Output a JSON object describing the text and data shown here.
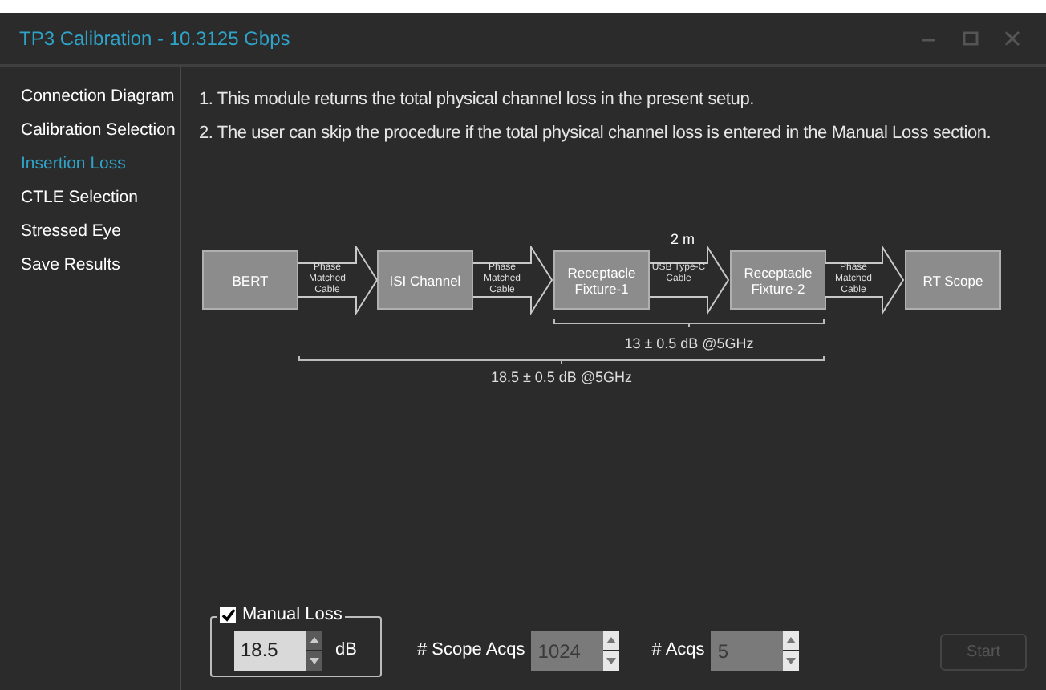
{
  "window": {
    "title": "TP3 Calibration - 10.3125 Gbps"
  },
  "sidebar": {
    "items": [
      {
        "label": "Connection Diagram",
        "selected": false
      },
      {
        "label": "Calibration Selection",
        "selected": false
      },
      {
        "label": "Insertion Loss",
        "selected": true
      },
      {
        "label": "CTLE Selection",
        "selected": false
      },
      {
        "label": "Stressed Eye",
        "selected": false
      },
      {
        "label": "Save Results",
        "selected": false
      }
    ]
  },
  "instructions": [
    "1. This module returns the total physical channel loss in the present setup.",
    "2. The user can skip the procedure if the total physical channel loss is entered in the Manual Loss section."
  ],
  "diagram": {
    "nodes": [
      {
        "label": "BERT"
      },
      {
        "label": "ISI Channel"
      },
      {
        "label": "Receptacle Fixture-1"
      },
      {
        "label": "Receptacle Fixture-2"
      },
      {
        "label": "RT Scope"
      }
    ],
    "links": [
      {
        "label": "Phase Matched Cable"
      },
      {
        "label": "Phase Matched Cable"
      },
      {
        "label": "USB Type-C Cable",
        "length": "2 m"
      },
      {
        "label": "Phase Matched Cable"
      }
    ],
    "spans": [
      {
        "label": "13 ± 0.5 dB @5GHz"
      },
      {
        "label": "18.5 ± 0.5 dB @5GHz"
      }
    ]
  },
  "manual_loss": {
    "label": "Manual Loss",
    "checked": true,
    "value": "18.5",
    "unit": "dB"
  },
  "scope_acqs": {
    "label": "# Scope Acqs",
    "value": "1024",
    "disabled": true
  },
  "acqs": {
    "label": "# Acqs",
    "value": "5",
    "disabled": true
  },
  "start_button": {
    "label": "Start",
    "disabled": true
  }
}
